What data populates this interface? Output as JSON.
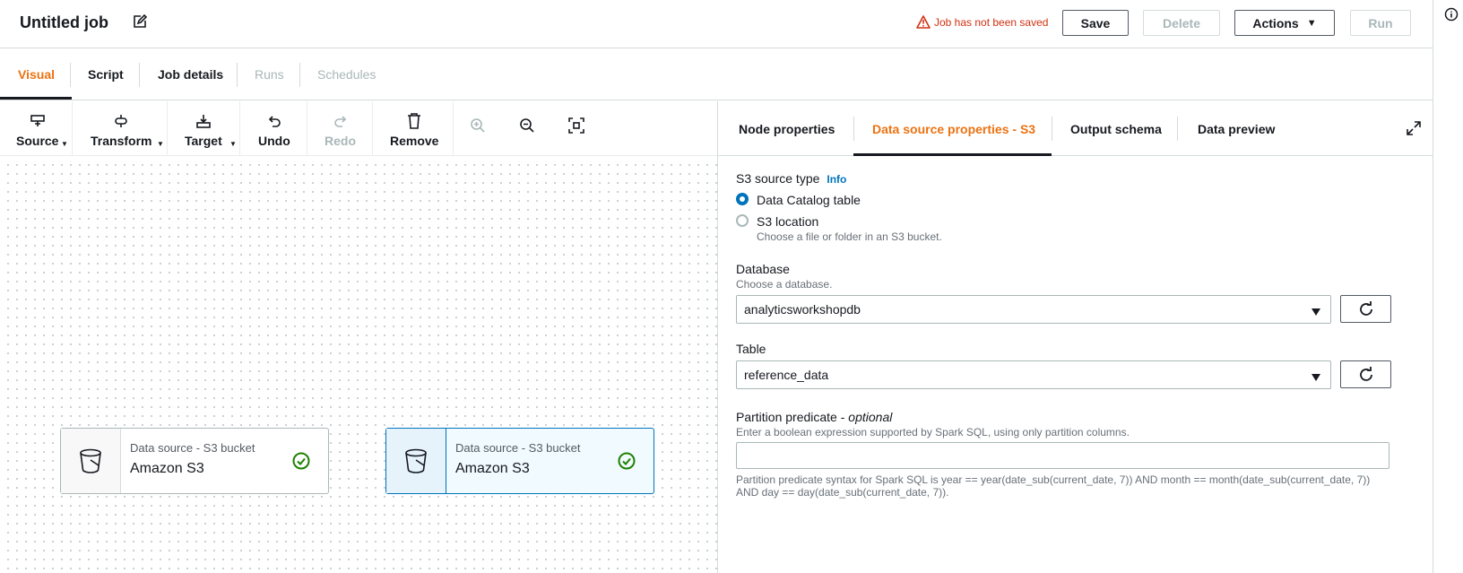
{
  "header": {
    "title": "Untitled job",
    "warning": "Job has not been saved",
    "save": "Save",
    "delete": "Delete",
    "actions": "Actions",
    "run": "Run"
  },
  "tabs": [
    "Visual",
    "Script",
    "Job details",
    "Runs",
    "Schedules"
  ],
  "toolbar": {
    "source": "Source",
    "transform": "Transform",
    "target": "Target",
    "undo": "Undo",
    "redo": "Redo",
    "remove": "Remove"
  },
  "nodes": [
    {
      "type": "Data source - S3 bucket",
      "name": "Amazon S3"
    },
    {
      "type": "Data source - S3 bucket",
      "name": "Amazon S3"
    }
  ],
  "panel": {
    "tabs": [
      "Node properties",
      "Data source properties - S3",
      "Output schema",
      "Data preview"
    ],
    "source_type_label": "S3 source type",
    "info": "Info",
    "option_catalog": "Data Catalog table",
    "option_location": "S3 location",
    "option_location_desc": "Choose a file or folder in an S3 bucket.",
    "database_label": "Database",
    "database_desc": "Choose a database.",
    "database_value": "analyticsworkshopdb",
    "table_label": "Table",
    "table_value": "reference_data",
    "partition_label": "Partition predicate - ",
    "partition_optional": "optional",
    "partition_desc": "Enter a boolean expression supported by Spark SQL, using only partition columns.",
    "partition_value": "",
    "partition_hint": "Partition predicate syntax for Spark SQL is year == year(date_sub(current_date, 7)) AND month == month(date_sub(current_date, 7)) AND day == day(date_sub(current_date, 7))."
  },
  "colors": {
    "accent": "#ec7211",
    "link": "#0073bb",
    "error": "#d13212",
    "success": "#1d8102"
  }
}
